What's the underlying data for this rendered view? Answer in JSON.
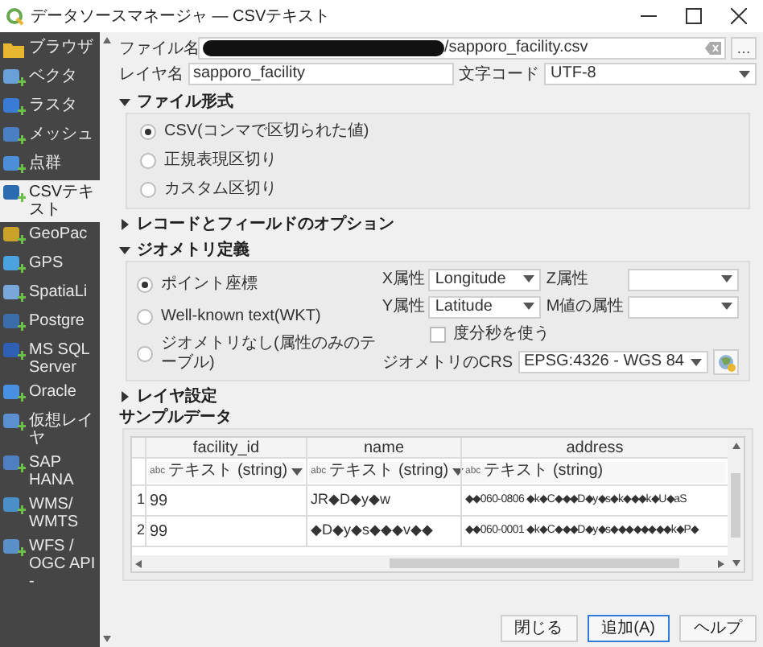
{
  "window": {
    "title": "データソースマネージャ — CSVテキスト"
  },
  "sidebar": {
    "items": [
      {
        "label": "ブラウザ",
        "selected": false
      },
      {
        "label": "ベクタ",
        "selected": false
      },
      {
        "label": "ラスタ",
        "selected": false
      },
      {
        "label": "メッシュ",
        "selected": false
      },
      {
        "label": "点群",
        "selected": false
      },
      {
        "label": "CSVテキスト",
        "selected": true
      },
      {
        "label": "GeoPac",
        "selected": false
      },
      {
        "label": "GPS",
        "selected": false
      },
      {
        "label": "SpatiaLi",
        "selected": false
      },
      {
        "label": "Postgre",
        "selected": false
      },
      {
        "label": "MS SQL Server",
        "selected": false
      },
      {
        "label": "Oracle",
        "selected": false
      },
      {
        "label": "仮想レイヤ",
        "selected": false
      },
      {
        "label": "SAP HANA",
        "selected": false
      },
      {
        "label": "WMS/ WMTS",
        "selected": false
      },
      {
        "label": "WFS / OGC API -",
        "selected": false
      }
    ]
  },
  "file": {
    "label": "ファイル名",
    "value": "/sapporo_facility.csv",
    "redacted": true,
    "browse": "…"
  },
  "layer_name": {
    "label": "レイヤ名",
    "value": "sapporo_facility"
  },
  "encoding": {
    "label": "文字コード",
    "value": "UTF-8"
  },
  "file_format": {
    "title": "ファイル形式",
    "expanded": true,
    "options": [
      {
        "label": "CSV(コンマで区切られた値)",
        "selected": true
      },
      {
        "label": "正規表現区切り",
        "selected": false
      },
      {
        "label": "カスタム区切り",
        "selected": false
      }
    ]
  },
  "record_options": {
    "title": "レコードとフィールドのオプション",
    "expanded": false
  },
  "geometry": {
    "title": "ジオメトリ定義",
    "expanded": true,
    "options": [
      {
        "label": "ポイント座標",
        "selected": true
      },
      {
        "label": "Well-known text(WKT)",
        "selected": false
      },
      {
        "label": "ジオメトリなし(属性のみのテーブル)",
        "selected": false
      }
    ],
    "x_field": {
      "label": "X属性",
      "value": "Longitude"
    },
    "z_field": {
      "label": "Z属性"
    },
    "y_field": {
      "label": "Y属性",
      "value": "Latitude"
    },
    "m_field": {
      "label": "M値の属性"
    },
    "dms": {
      "label": "度分秒を使う",
      "checked": false
    },
    "crs": {
      "label": "ジオメトリのCRS",
      "value": "EPSG:4326 - WGS 84"
    }
  },
  "layer_settings": {
    "title": "レイヤ設定",
    "expanded": false
  },
  "sample": {
    "title": "サンプルデータ",
    "columns": [
      {
        "name": "facility_id",
        "badge": "abc",
        "type": "テキスト (string)",
        "dropdown": true
      },
      {
        "name": "name",
        "badge": "abc",
        "type": "テキスト (string)",
        "dropdown": true
      },
      {
        "name": "address",
        "badge": "abc",
        "type": "テキスト (string)",
        "dropdown": false
      }
    ],
    "rows": [
      {
        "number": "1",
        "cells": [
          "99",
          "JR◆D◆y◆w",
          "◆◆060-0806 ◆k◆C◆◆◆D◆y◆s◆k◆◆◆k◆U◆aS"
        ]
      },
      {
        "number": "2",
        "cells": [
          "99",
          "◆D◆y◆s◆◆◆v◆◆",
          "◆◆060-0001 ◆k◆C◆◆◆D◆y◆s◆◆◆◆◆◆◆◆k◆P◆"
        ]
      }
    ]
  },
  "buttons": [
    {
      "label": "閉じる",
      "default": false
    },
    {
      "label": "追加(A)",
      "default": true
    },
    {
      "label": "ヘルプ",
      "default": false
    }
  ]
}
